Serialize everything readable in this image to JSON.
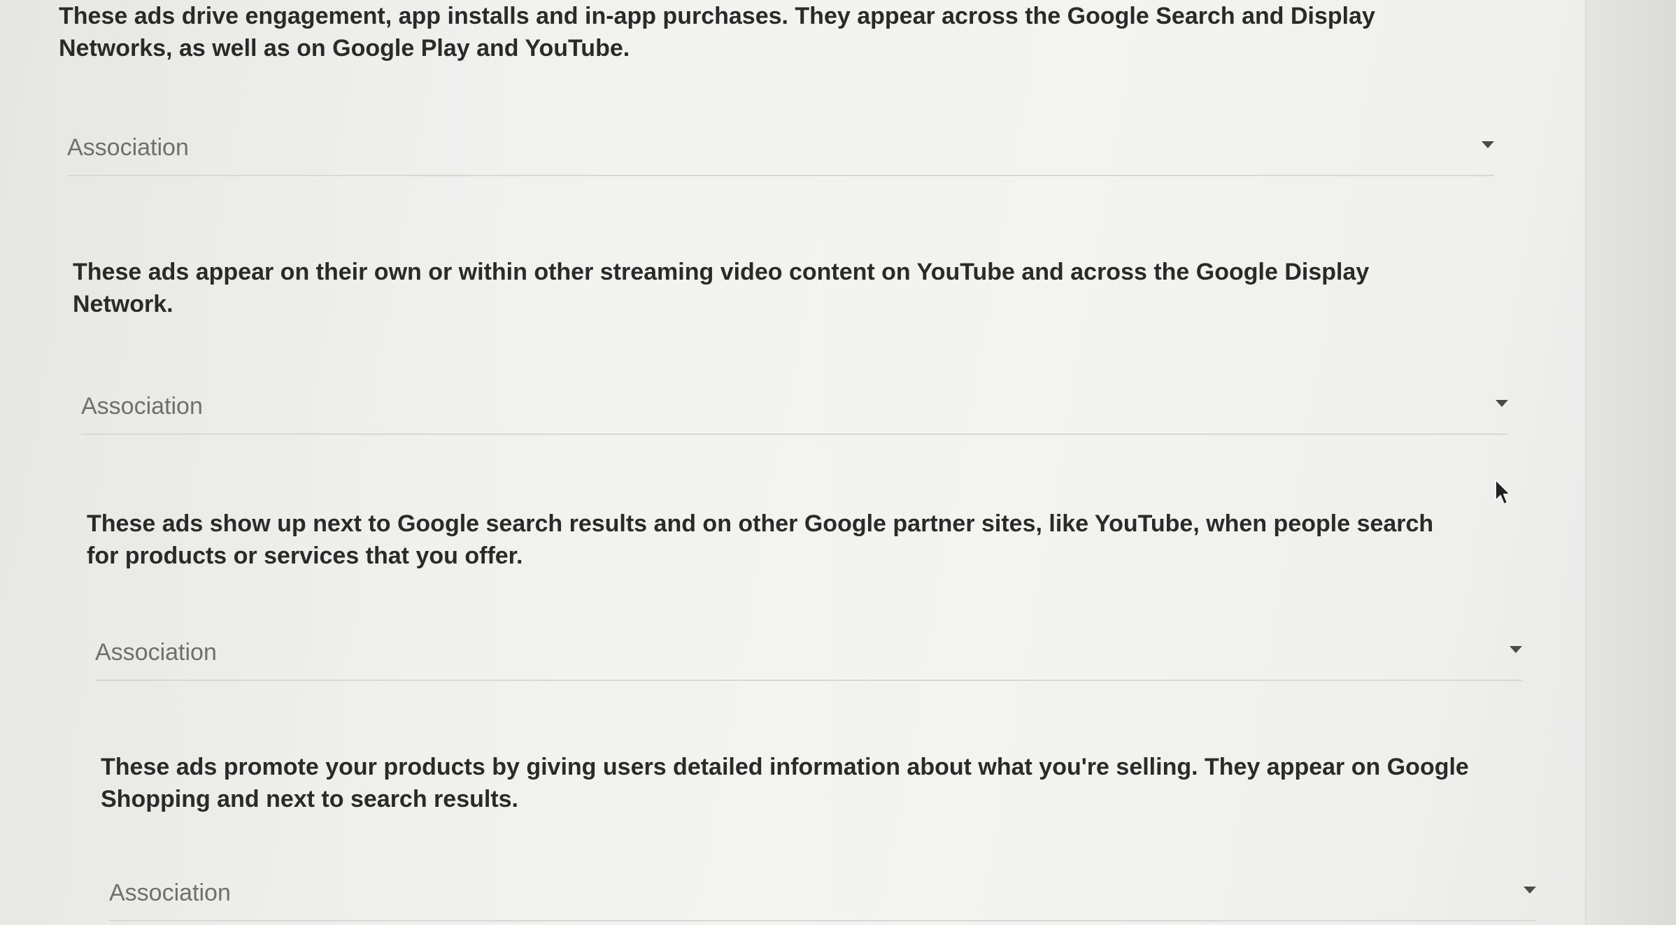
{
  "questions": [
    {
      "description": "These ads drive engagement, app installs and in-app purchases. They appear across the Google Search and Display\nNetworks, as well as on Google Play and YouTube.",
      "select_value": "Association"
    },
    {
      "description": "These ads appear on their own or within other streaming video content on YouTube and across the Google Display\nNetwork.",
      "select_value": "Association"
    },
    {
      "description": "These ads show up next to Google search results and on other Google partner sites, like YouTube, when people search\nfor products or services that you offer.",
      "select_value": "Association"
    },
    {
      "description": "These ads promote your products by giving users detailed information about what you're selling. They appear on Google\nShopping and next to search results.",
      "select_value": "Association"
    }
  ],
  "icons": {
    "dropdown": "chevron-down-icon",
    "cursor": "mouse-pointer-icon"
  }
}
